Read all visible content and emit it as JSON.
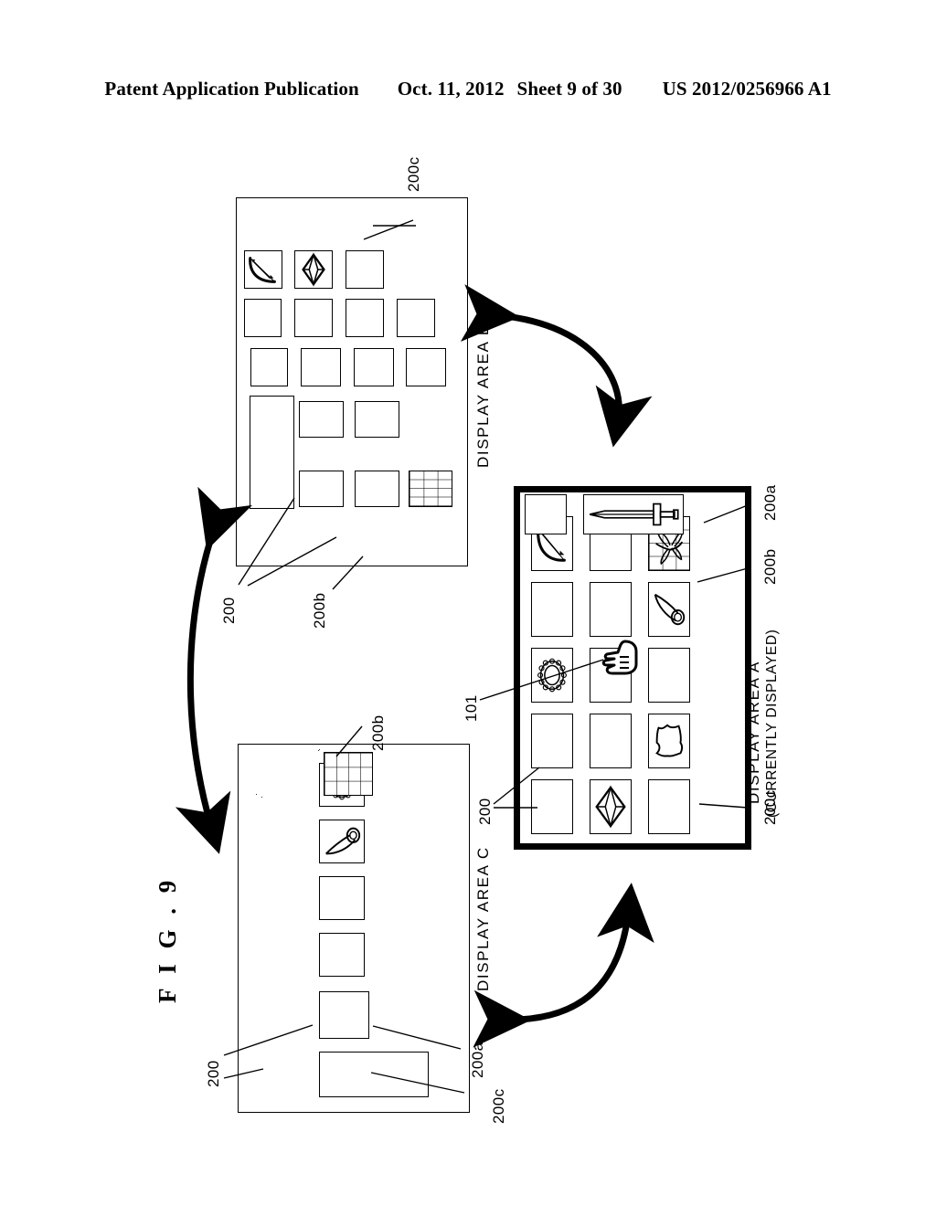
{
  "header": {
    "publication": "Patent Application Publication",
    "date": "Oct. 11, 2012",
    "sheet": "Sheet 9 of 30",
    "number": "US 2012/0256966 A1"
  },
  "figure": {
    "label": "F I G .  9"
  },
  "panels": {
    "area_b": {
      "title": "DISPLAY AREA B",
      "refs": [
        "200c",
        "200",
        "200b"
      ],
      "icons": [
        "bow-and-arrow-icon",
        "gemstone-icon",
        "net-icon"
      ]
    },
    "area_a": {
      "title": "DISPLAY AREA A",
      "subtitle": "(CURRENTLY DISPLAYED)",
      "refs": [
        "200a",
        "200b",
        "101",
        "200",
        "200c"
      ],
      "icons": [
        "bow-and-arrow-icon",
        "net-with-dragonfly-icon",
        "horn-icon",
        "beaded-ring-icon",
        "gemstone-icon",
        "armor-icon",
        "sword-icon",
        "hand-cursor-icon"
      ]
    },
    "area_c": {
      "title": "DISPLAY AREA C",
      "refs": [
        "200b",
        "200",
        "200a",
        "200c"
      ],
      "icons": [
        "net-icon",
        "beaded-ring-icon",
        "horn-icon"
      ]
    }
  },
  "arrows": {
    "b_to_a": "double-headed-curved-arrow",
    "b_to_c": "double-headed-curved-arrow",
    "c_to_a": "double-headed-curved-arrow"
  },
  "colors": {
    "ink": "#000000",
    "paper": "#ffffff"
  }
}
